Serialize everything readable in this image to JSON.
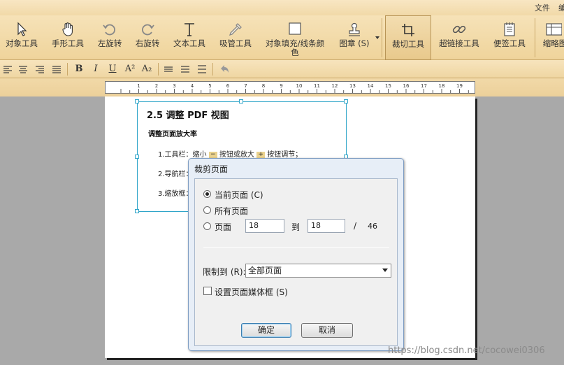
{
  "menubar": {
    "items": [
      {
        "label": "文件"
      },
      {
        "label": "编"
      }
    ]
  },
  "ribbon": {
    "tools": [
      {
        "label": "对象工具",
        "icon": "cursor-arrow-icon"
      },
      {
        "label": "手形工具",
        "icon": "hand-icon"
      },
      {
        "label": "左旋转",
        "icon": "rotate-left-icon"
      },
      {
        "label": "右旋转",
        "icon": "rotate-right-icon"
      },
      {
        "label": "文本工具",
        "icon": "text-t-icon"
      },
      {
        "label": "吸管工具",
        "icon": "eyedropper-icon"
      },
      {
        "label": "对象填充/线条颜色",
        "line1": "对象填充/线条颜",
        "line2": "色",
        "icon": "color-swatch-icon"
      },
      {
        "label": "图章 (S)",
        "icon": "stamp-icon"
      },
      {
        "label": "裁切工具",
        "icon": "crop-icon",
        "active": true
      },
      {
        "label": "超链接工具",
        "icon": "link-icon"
      },
      {
        "label": "便签工具",
        "icon": "sticky-note-icon"
      },
      {
        "label": "缩略图",
        "icon": "thumbnail-icon"
      }
    ]
  },
  "formatbar": {
    "bold": "B",
    "italic": "I",
    "underline": "U",
    "superscript": "A²",
    "subscript": "A₂"
  },
  "ruler": {
    "ticks": [
      "1",
      "2",
      "3",
      "4",
      "5",
      "6",
      "7",
      "8",
      "9",
      "10",
      "11",
      "12",
      "13",
      "14",
      "15",
      "16",
      "17",
      "18",
      "19",
      "20"
    ]
  },
  "document": {
    "heading": "2.5 调整 PDF 视图",
    "subheading": "调整页面放大率",
    "line1_a": "1.工具栏：缩小",
    "line1_b": "按钮或放大",
    "line1_c": "按钮调节；",
    "line2": "2.导航栏：",
    "line3": "3.缩放框："
  },
  "dialog": {
    "title": "裁剪页面",
    "radio_current": "当前页面 (C)",
    "radio_all": "所有页面",
    "radio_pages": "页面",
    "from_value": "18",
    "to_label": "到",
    "to_value": "18",
    "slash": "/",
    "total_pages": "46",
    "limit_label": "限制到 (R):",
    "limit_value": "全部页面",
    "checkbox_label": "设置页面媒体框 (S)",
    "ok": "确定",
    "cancel": "取消"
  },
  "watermark": "https://blog.csdn.net/cocowei0306"
}
